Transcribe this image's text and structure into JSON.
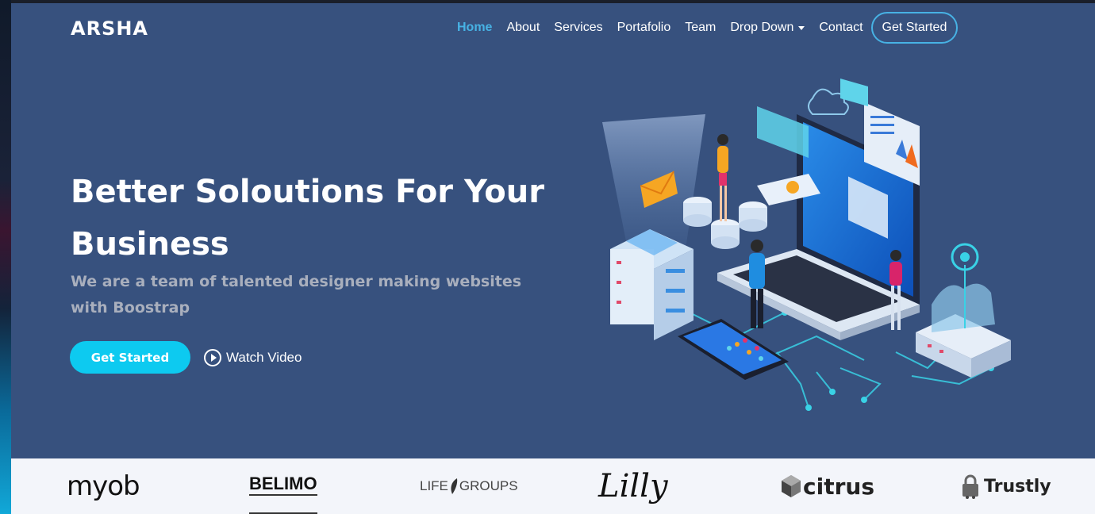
{
  "header": {
    "logo": "ARSHA",
    "nav": [
      {
        "label": "Home",
        "active": true
      },
      {
        "label": "About"
      },
      {
        "label": "Services"
      },
      {
        "label": "Portafolio"
      },
      {
        "label": "Team"
      },
      {
        "label": "Drop Down",
        "dropdown": true
      },
      {
        "label": "Contact"
      }
    ],
    "cta": "Get Started"
  },
  "hero": {
    "title": "Better Soloutions For Your Business",
    "subtitle": "We are a team of talented designer making websites with Boostrap",
    "primary_button": "Get Started",
    "secondary_button": "Watch Video"
  },
  "clients": {
    "logos": [
      {
        "name": "myob",
        "text": "myob"
      },
      {
        "name": "belimo",
        "text": "BELIMO"
      },
      {
        "name": "lifegroups",
        "text_left": "LIFE",
        "text_right": "GROUPS"
      },
      {
        "name": "lilly",
        "text": "Lilly"
      },
      {
        "name": "citrus",
        "text": "citrus"
      },
      {
        "name": "trustly",
        "text": "Trustly"
      }
    ]
  },
  "colors": {
    "hero_bg": "#37517e",
    "accent": "#47b2e4",
    "button": "#0dcaf0",
    "clients_bg": "#f3f5fa"
  }
}
